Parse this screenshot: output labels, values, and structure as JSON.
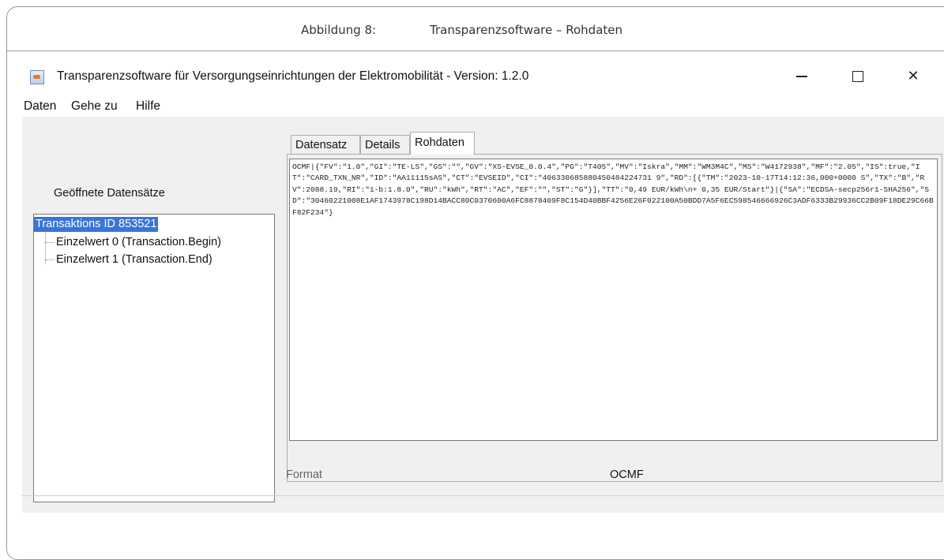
{
  "caption": {
    "label": "Abbildung 8:",
    "text": "Transparenzsoftware – Rohdaten"
  },
  "window": {
    "title": "Transparenzsoftware für Versorgungseinrichtungen der Elektromobilität - Version: 1.2.0",
    "controls": {
      "minimize_icon": "minimize-icon",
      "maximize_icon": "maximize-icon",
      "close_icon": "close-icon",
      "close_glyph": "✕"
    }
  },
  "menu": {
    "items": [
      "Daten",
      "Gehe zu",
      "Hilfe"
    ]
  },
  "left_panel": {
    "label": "Geöffnete Datensätze",
    "tree": {
      "root": "Transaktions ID 853521",
      "children": [
        "Einzelwert 0 (Transaction.Begin)",
        "Einzelwert 1 (Transaction.End)"
      ]
    }
  },
  "tabs": [
    "Datensatz",
    "Details",
    "Rohdaten"
  ],
  "selected_tab": "Rohdaten",
  "raw_data": "OCMF|{\"FV\":\"1.0\",\"GI\":\"TE-LS\",\"GS\":\"\",\"GV\":\"XS-EVSE_0.0.4\",\"PG\":\"T405\",\"MV\":\"Iskra\",\"MM\":\"WM3M4C\",\"MS\":\"W4172938\",\"MF\":\"2.05\",\"IS\":true,\"IT\":\"CARD_TXN_NR\",\"ID\":\"AA11115sAS\",\"CT\":\"EVSEID\",\"CI\":\"406330685880450484224731 9\",\"RD\":[{\"TM\":\"2023-10-17T14:12:36,000+0000 S\",\"TX\":\"B\",\"RV\":2088.19,\"RI\":\"1-b:1.8.0\",\"RU\":\"kWh\",\"RT\":\"AC\",\"EF\":\"\",\"ST\":\"G\"}],\"TT\":\"0,49 EUR/kWh\\n+ 0,35 EUR/Start\"}|{\"SA\":\"ECDSA-secp256r1-SHA256\",\"SD\":\"30460221008E1AF1743978C198D14BACC80C0370600A6FC8878409F8C154D40BBF4256E26F022100A50BDD7A5F6EC598546666926C3ADF6333B29936CC2B09F18DE29C66BF82F234\"}",
  "format": {
    "label": "Format",
    "value": "OCMF"
  },
  "colors": {
    "selection": "#3875d7",
    "window_bg": "#f0f0f0"
  }
}
